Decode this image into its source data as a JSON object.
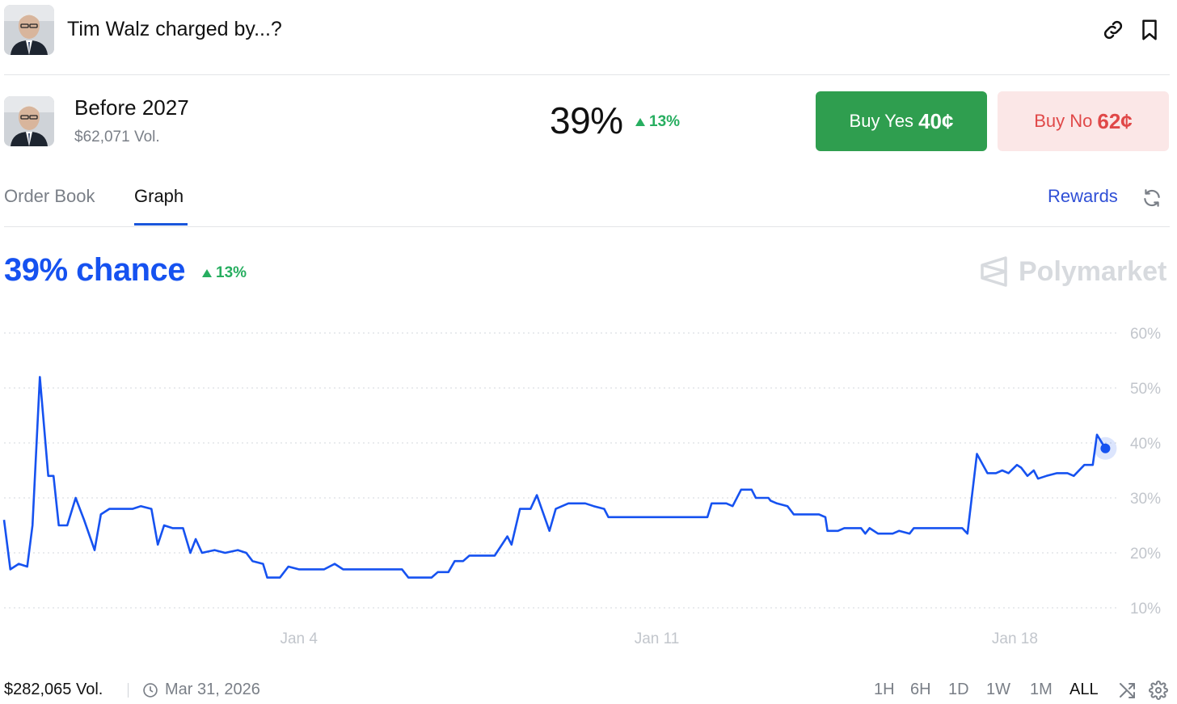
{
  "header": {
    "title": "Tim Walz charged by...?",
    "link_icon": "link-icon",
    "bookmark_icon": "bookmark-icon"
  },
  "outcome": {
    "name": "Before 2027",
    "volume": "$62,071 Vol.",
    "probability": "39%",
    "change": "13%",
    "buy_yes": {
      "label": "Buy Yes",
      "price": "40¢"
    },
    "buy_no": {
      "label": "Buy No",
      "price": "62¢"
    }
  },
  "tabs": [
    {
      "label": "Order Book"
    },
    {
      "label": "Graph",
      "active": true
    }
  ],
  "rewards_label": "Rewards",
  "chart_header": {
    "chance": "39% chance",
    "change": "13%",
    "brand": "Polymarket"
  },
  "chart_data": {
    "type": "line",
    "series": [
      {
        "color": "#1652f0",
        "points": [
          [
            0,
            26
          ],
          [
            0.3,
            17
          ],
          [
            0.7,
            18
          ],
          [
            1.1,
            17.5
          ],
          [
            1.35,
            25
          ],
          [
            1.7,
            52
          ],
          [
            2.1,
            34
          ],
          [
            2.35,
            34
          ],
          [
            2.6,
            25
          ],
          [
            3,
            25
          ],
          [
            3.4,
            30
          ],
          [
            3.8,
            26
          ],
          [
            4.3,
            20.5
          ],
          [
            4.6,
            27
          ],
          [
            5,
            28
          ],
          [
            5.5,
            28
          ],
          [
            6.1,
            28
          ],
          [
            6.5,
            28.5
          ],
          [
            7,
            28
          ],
          [
            7.3,
            21.5
          ],
          [
            7.6,
            25
          ],
          [
            8,
            24.5
          ],
          [
            8.5,
            24.5
          ],
          [
            8.85,
            20
          ],
          [
            9.1,
            22.5
          ],
          [
            9.4,
            20
          ],
          [
            10,
            20.5
          ],
          [
            10.5,
            20
          ],
          [
            11.1,
            20.5
          ],
          [
            11.5,
            20
          ],
          [
            11.8,
            18.5
          ],
          [
            12.3,
            18
          ],
          [
            12.5,
            15.5
          ],
          [
            13.1,
            15.5
          ],
          [
            13.5,
            17.5
          ],
          [
            14,
            17
          ],
          [
            15.2,
            17
          ],
          [
            15.7,
            18
          ],
          [
            16.1,
            17
          ],
          [
            18.9,
            17
          ],
          [
            19.2,
            15.5
          ],
          [
            20.3,
            15.5
          ],
          [
            20.6,
            16.5
          ],
          [
            21.1,
            16.5
          ],
          [
            21.4,
            18.5
          ],
          [
            21.8,
            18.5
          ],
          [
            22.1,
            19.5
          ],
          [
            23.3,
            19.5
          ],
          [
            23.9,
            23
          ],
          [
            24.1,
            21.5
          ],
          [
            24.5,
            28
          ],
          [
            25,
            28
          ],
          [
            25.3,
            30.5
          ],
          [
            25.9,
            24
          ],
          [
            26.2,
            28
          ],
          [
            26.8,
            29
          ],
          [
            27.6,
            29
          ],
          [
            28,
            28.5
          ],
          [
            28.5,
            28
          ],
          [
            28.7,
            26.5
          ],
          [
            33.4,
            26.5
          ],
          [
            33.6,
            29
          ],
          [
            34.3,
            29
          ],
          [
            34.6,
            28.5
          ],
          [
            35,
            31.5
          ],
          [
            35.5,
            31.5
          ],
          [
            35.7,
            30
          ],
          [
            36.3,
            30
          ],
          [
            36.4,
            29.5
          ],
          [
            36.7,
            29
          ],
          [
            37.2,
            28.5
          ],
          [
            37.5,
            27
          ],
          [
            38.7,
            27
          ],
          [
            39,
            26.5
          ],
          [
            39.1,
            24
          ],
          [
            39.6,
            24
          ],
          [
            39.9,
            24.5
          ],
          [
            40.7,
            24.5
          ],
          [
            40.9,
            23.5
          ],
          [
            41.1,
            24.5
          ],
          [
            41.5,
            23.5
          ],
          [
            42.2,
            23.5
          ],
          [
            42.5,
            24
          ],
          [
            43,
            23.5
          ],
          [
            43.2,
            24.5
          ],
          [
            43.6,
            24.5
          ],
          [
            44.4,
            24.5
          ],
          [
            45.5,
            24.5
          ],
          [
            45.75,
            23.5
          ],
          [
            46.2,
            38
          ],
          [
            46.7,
            34.5
          ],
          [
            47.1,
            34.5
          ],
          [
            47.4,
            35
          ],
          [
            47.7,
            34.5
          ],
          [
            48.1,
            36
          ],
          [
            48.3,
            35.5
          ],
          [
            48.6,
            34
          ],
          [
            48.9,
            35
          ],
          [
            49.1,
            33.5
          ],
          [
            49.5,
            34
          ],
          [
            50,
            34.5
          ],
          [
            50.5,
            34.5
          ],
          [
            50.8,
            34
          ],
          [
            51.3,
            36
          ],
          [
            51.7,
            36
          ],
          [
            51.9,
            41.5
          ],
          [
            52.3,
            39
          ]
        ]
      }
    ],
    "yticks": [
      "60%",
      "50%",
      "40%",
      "30%",
      "20%",
      "10%"
    ],
    "ylim": [
      10,
      60
    ],
    "xticks": [
      {
        "label": "Jan 4",
        "day": 14
      },
      {
        "label": "Jan 11",
        "day": 31
      },
      {
        "label": "Jan 18",
        "day": 48
      }
    ],
    "xlim": [
      0,
      56
    ],
    "grid": true,
    "last_value": 39
  },
  "footer": {
    "volume": "$282,065 Vol.",
    "date": "Mar 31, 2026",
    "ranges": [
      "1H",
      "6H",
      "1D",
      "1W",
      "1M",
      "ALL"
    ],
    "active_range": "ALL"
  }
}
